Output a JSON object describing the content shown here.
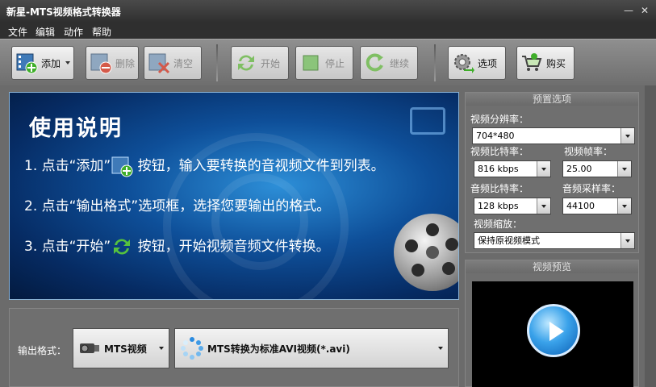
{
  "window": {
    "title": "新星-MTS视频格式转换器",
    "minimize": "—",
    "close": "✕"
  },
  "menu": [
    "文件",
    "编辑",
    "动作",
    "帮助"
  ],
  "toolbar": {
    "add": "添加",
    "delete": "删除",
    "clear": "清空",
    "start": "开始",
    "stop": "停止",
    "resume": "继续",
    "options": "选项",
    "buy": "购买"
  },
  "banner": {
    "heading": "使用说明",
    "step1_pre": "1. 点击“添加”",
    "step1_post": " 按钮，输入要转换的音视频文件到列表。",
    "step2": "2. 点击“输出格式”选项框，选择您要输出的格式。",
    "step3_pre": "3. 点击“开始”",
    "step3_post": " 按钮，开始视频音频文件转换。"
  },
  "output": {
    "label": "输出格式：",
    "format": "MTS视频",
    "profile": "MTS转换为标准AVI视频(*.avi)"
  },
  "preset": {
    "title": "预置选项",
    "resolution_label": "视频分辨率：",
    "resolution": "704*480",
    "video_bitrate_label": "视频比特率：",
    "video_bitrate": "816 kbps",
    "framerate_label": "视频帧率：",
    "framerate": "25.00",
    "audio_bitrate_label": "音频比特率：",
    "audio_bitrate": "128 kbps",
    "samplerate_label": "音频采样率：",
    "samplerate": "44100",
    "scale_label": "视频缩放：",
    "scale": "保持原视频模式"
  },
  "preview": {
    "title": "视频预览"
  },
  "colors": {
    "toolbar_bg": "#808080",
    "banner_blue": "#0e4f99",
    "panel_bg": "#6f6f6f"
  }
}
